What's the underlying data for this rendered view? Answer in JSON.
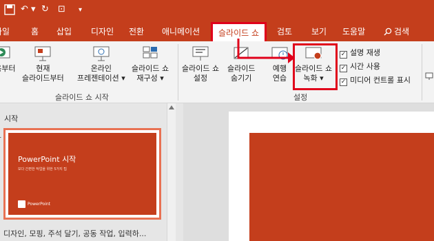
{
  "quick_access": {
    "undo_glyph": "↶ ▾",
    "redo_glyph": "↻",
    "present_glyph": "⊡",
    "more_glyph": "▾"
  },
  "tabs": [
    {
      "label": "파일"
    },
    {
      "label": "홈"
    },
    {
      "label": "삽입"
    },
    {
      "label": "디자인"
    },
    {
      "label": "전환"
    },
    {
      "label": "애니메이션"
    },
    {
      "label": "슬라이드 쇼"
    },
    {
      "label": "검토"
    },
    {
      "label": "보기"
    },
    {
      "label": "도움말"
    },
    {
      "label": "검색"
    }
  ],
  "ribbon": {
    "start_group": {
      "from_beginning_label": "처음부터",
      "from_current_line1": "현재",
      "from_current_line2": "슬라이드부터",
      "online_line1": "온라인",
      "online_line2": "프레젠테이션 ▾",
      "custom_line1": "슬라이드 쇼",
      "custom_line2": "재구성 ▾",
      "group_label": "슬라이드 쇼 시작"
    },
    "setup_group": {
      "setup_line1": "슬라이드 쇼",
      "setup_line2": "설정",
      "hide_line1": "슬라이드",
      "hide_line2": "숨기기",
      "rehearse_line1": "예행",
      "rehearse_line2": "연습",
      "record_line1": "슬라이드 쇼",
      "record_line2": "녹화 ▾",
      "group_label": "설정",
      "checkboxes": [
        {
          "label": "설명 재생",
          "checked": true
        },
        {
          "label": "시간 사용",
          "checked": true
        },
        {
          "label": "미디어 컨트롤 표시",
          "checked": true
        }
      ]
    }
  },
  "left_pane": {
    "section_title": "시작",
    "slide_number": "1",
    "thumb_title": "PowerPoint 시작",
    "thumb_subtitle": "보다 간편한 작업을 위한 5가지 팁",
    "thumb_brand": "PowerPoint",
    "status_text": "디자인, 모핑, 주석 달기, 공동 작업, 입력하..."
  },
  "colors": {
    "brand": "#c43e1c",
    "highlight": "#e0001a"
  }
}
